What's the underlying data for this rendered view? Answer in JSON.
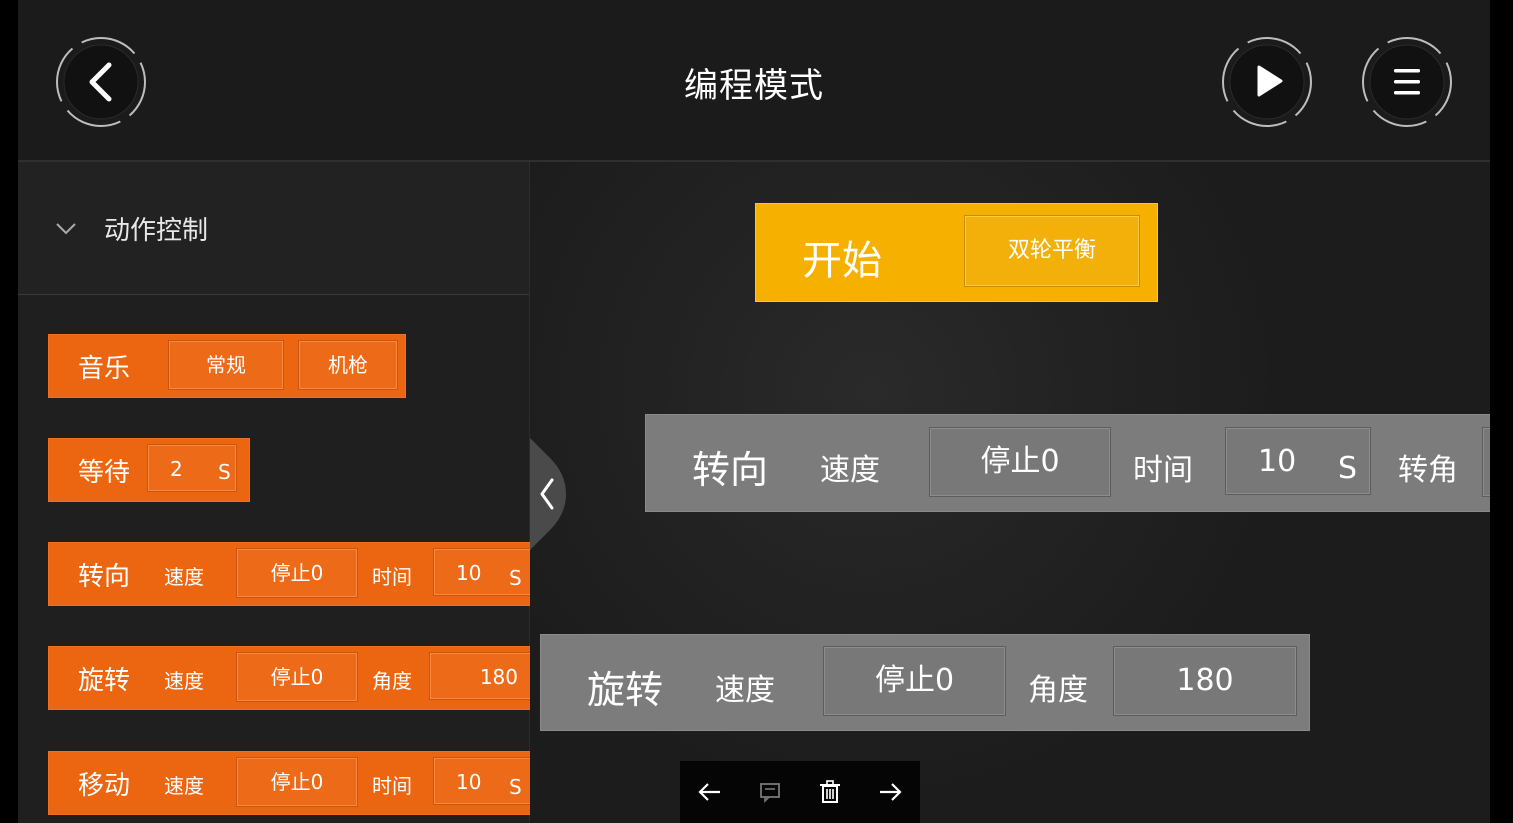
{
  "header": {
    "title": "编程模式",
    "back_icon": "back-chevron-icon",
    "play_icon": "play-icon",
    "menu_icon": "hamburger-menu-icon"
  },
  "sidebar": {
    "category": "动作控制",
    "blocks": {
      "music": {
        "label": "音乐",
        "opt1": "常规",
        "opt2": "机枪"
      },
      "wait": {
        "label": "等待",
        "value": "2",
        "unit": "S"
      },
      "turn": {
        "label": "转向",
        "speed_label": "速度",
        "speed": "停止0",
        "time_label": "时间",
        "time": "10",
        "unit": "S"
      },
      "rotate": {
        "label": "旋转",
        "speed_label": "速度",
        "speed": "停止0",
        "angle_label": "角度",
        "angle": "180"
      },
      "move": {
        "label": "移动",
        "speed_label": "速度",
        "speed": "停止0",
        "time_label": "时间",
        "time": "10",
        "unit": "S"
      }
    }
  },
  "canvas": {
    "start": {
      "label": "开始",
      "mode": "双轮平衡"
    },
    "turn": {
      "label": "转向",
      "speed_label": "速度",
      "speed": "停止0",
      "time_label": "时间",
      "time": "10",
      "unit": "S",
      "angle_label": "转角"
    },
    "rotate": {
      "label": "旋转",
      "speed_label": "速度",
      "speed": "停止0",
      "angle_label": "角度",
      "angle": "180"
    }
  },
  "colors": {
    "orange_block": "#ec6510",
    "start_block": "#f5b000",
    "gray_block": "#7c7c7c",
    "background": "#1c1c1c"
  }
}
